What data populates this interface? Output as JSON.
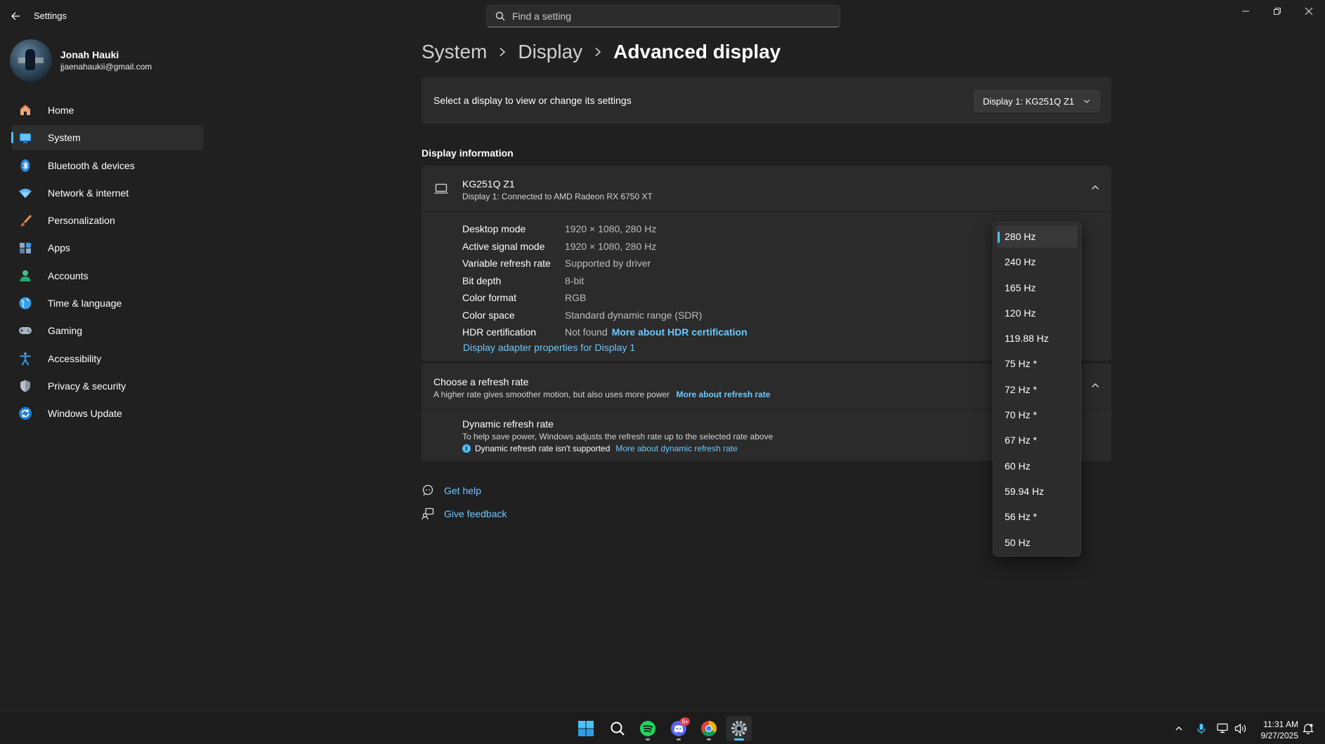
{
  "window": {
    "title": "Settings",
    "search_placeholder": "Find a setting"
  },
  "user": {
    "name": "Jonah Hauki",
    "email": "jjaenahaukii@gmail.com"
  },
  "sidebar": {
    "items": [
      {
        "label": "Home",
        "icon": "home-icon"
      },
      {
        "label": "System",
        "icon": "system-icon",
        "active": true
      },
      {
        "label": "Bluetooth & devices",
        "icon": "bluetooth-icon"
      },
      {
        "label": "Network & internet",
        "icon": "wifi-icon"
      },
      {
        "label": "Personalization",
        "icon": "brush-icon"
      },
      {
        "label": "Apps",
        "icon": "apps-icon"
      },
      {
        "label": "Accounts",
        "icon": "accounts-icon"
      },
      {
        "label": "Time & language",
        "icon": "globe-icon"
      },
      {
        "label": "Gaming",
        "icon": "gamepad-icon"
      },
      {
        "label": "Accessibility",
        "icon": "accessibility-icon"
      },
      {
        "label": "Privacy & security",
        "icon": "shield-icon"
      },
      {
        "label": "Windows Update",
        "icon": "update-icon"
      }
    ]
  },
  "breadcrumb": [
    "System",
    "Display",
    "Advanced display"
  ],
  "display_select": {
    "label": "Select a display to view or change its settings",
    "value": "Display 1: KG251Q Z1"
  },
  "display_info": {
    "section_title": "Display information",
    "name": "KG251Q Z1",
    "subtitle": "Display 1: Connected to AMD Radeon RX 6750 XT",
    "rows": [
      {
        "key": "Desktop mode",
        "value": "1920 × 1080, 280 Hz"
      },
      {
        "key": "Active signal mode",
        "value": "1920 × 1080, 280 Hz"
      },
      {
        "key": "Variable refresh rate",
        "value": "Supported by driver"
      },
      {
        "key": "Bit depth",
        "value": "8-bit"
      },
      {
        "key": "Color format",
        "value": "RGB"
      },
      {
        "key": "Color space",
        "value": "Standard dynamic range (SDR)"
      },
      {
        "key": "HDR certification",
        "value": "Not found",
        "link": "More about HDR certification"
      }
    ],
    "adapter_link": "Display adapter properties for Display 1"
  },
  "refresh": {
    "title": "Choose a refresh rate",
    "subtitle": "A higher rate gives smoother motion, but also uses more power",
    "subtitle_link": "More about refresh rate",
    "dynamic_title": "Dynamic refresh rate",
    "dynamic_desc": "To help save power, Windows adjusts the refresh rate up to the selected rate above",
    "dynamic_note": "Dynamic refresh rate isn't supported",
    "dynamic_link": "More about dynamic refresh rate"
  },
  "help": {
    "get_help": "Get help",
    "give_feedback": "Give feedback"
  },
  "refresh_dropdown": {
    "selected": "280 Hz",
    "options": [
      "280 Hz",
      "240 Hz",
      "165 Hz",
      "120 Hz",
      "119.88 Hz",
      "75 Hz *",
      "72 Hz *",
      "70 Hz *",
      "67 Hz *",
      "60 Hz",
      "59.94 Hz",
      "56 Hz *",
      "50 Hz"
    ]
  },
  "taskbar": {
    "apps": [
      "start-icon",
      "search-icon",
      "spotify-icon",
      "discord-icon",
      "chrome-icon",
      "settings-icon"
    ],
    "discord_badge": "9+",
    "time": "11:31 AM",
    "date": "9/27/2025"
  },
  "colors": {
    "background": "#202020",
    "card": "#2b2b2b",
    "accent": "#4cc2ff",
    "link": "#6cc8ff"
  }
}
